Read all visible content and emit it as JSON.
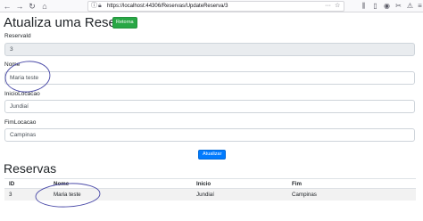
{
  "browser": {
    "url": "https://localhost:44306/Reservas/UpdateReserva/3"
  },
  "page": {
    "title": "Atualiza uma Reserva",
    "back_button": "Retorna",
    "fields": [
      {
        "label": "ReservaId",
        "value": "3"
      },
      {
        "label": "Nome",
        "value": "Maria teste"
      },
      {
        "label": "InicioLocacao",
        "value": "Jundiaí"
      },
      {
        "label": "FimLocacao",
        "value": "Campinas"
      }
    ],
    "submit_button": "Atualizar"
  },
  "reservas": {
    "title": "Reservas",
    "columns": [
      "ID",
      "Nome",
      "Inicio",
      "Fim"
    ],
    "rows": [
      [
        "3",
        "Maria teste",
        "Jundiaí",
        "Campinas"
      ]
    ]
  },
  "colors": {
    "annotation": "#4a4aa8",
    "primary": "#007bff",
    "success": "#28a745"
  }
}
